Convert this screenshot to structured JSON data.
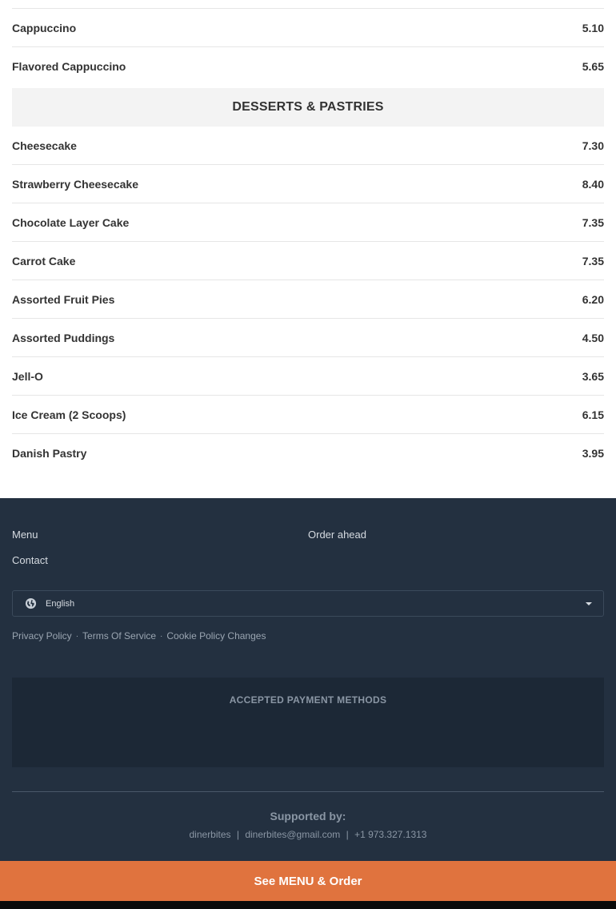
{
  "menu": {
    "coffee_items": [
      {
        "name": "Cappuccino",
        "price": "5.10"
      },
      {
        "name": "Flavored Cappuccino",
        "price": "5.65"
      }
    ],
    "desserts_heading": "DESSERTS & PASTRIES",
    "dessert_items": [
      {
        "name": "Cheesecake",
        "price": "7.30"
      },
      {
        "name": "Strawberry Cheesecake",
        "price": "8.40"
      },
      {
        "name": "Chocolate Layer Cake",
        "price": "7.35"
      },
      {
        "name": "Carrot Cake",
        "price": "7.35"
      },
      {
        "name": "Assorted Fruit Pies",
        "price": "6.20"
      },
      {
        "name": "Assorted Puddings",
        "price": "4.50"
      },
      {
        "name": "Jell-O",
        "price": "3.65"
      },
      {
        "name": "Ice Cream (2 Scoops)",
        "price": "6.15"
      },
      {
        "name": "Danish Pastry",
        "price": "3.95"
      }
    ]
  },
  "footer": {
    "links": {
      "menu": "Menu",
      "order_ahead": "Order ahead",
      "contact": "Contact"
    },
    "language": {
      "selected": "English",
      "icon": "globe-icon"
    },
    "legal": {
      "privacy": "Privacy Policy",
      "terms": "Terms Of Service",
      "cookie": "Cookie Policy Changes",
      "separator": "·"
    },
    "payment_heading": "ACCEPTED PAYMENT METHODS",
    "supported_by": "Supported by:",
    "contact": {
      "brand": "dinerbites",
      "email": "dinerbites@gmail.com",
      "phone": "+1 973.327.1313",
      "separator": "|"
    }
  },
  "order_bar": {
    "label": "See MENU & Order"
  },
  "colors": {
    "footer_bg": "#233040",
    "order_bar": "#e0733e",
    "section_head_bg": "#f3f3f3"
  }
}
